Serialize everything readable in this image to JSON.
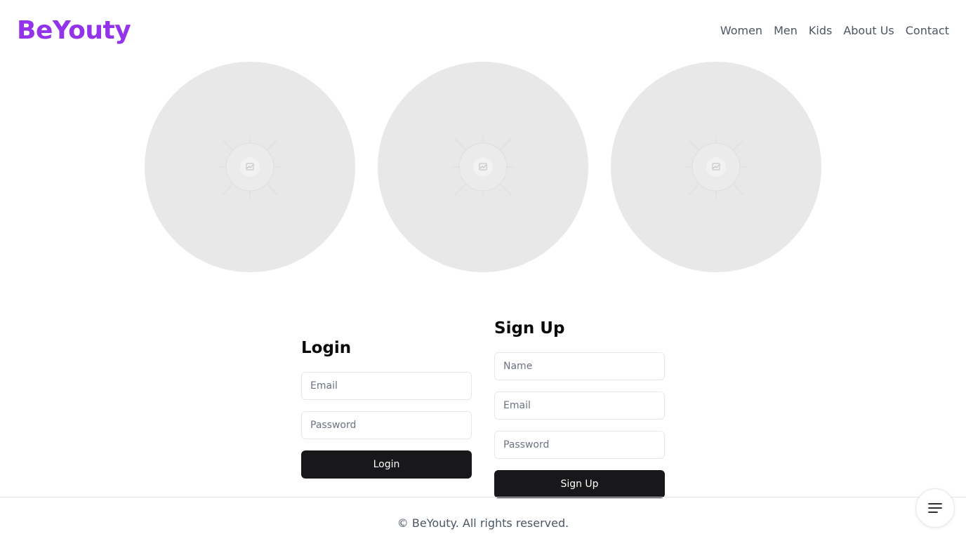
{
  "brand": {
    "name": "BeYouty",
    "color": "#9333ea"
  },
  "nav": {
    "items": [
      {
        "label": "Women"
      },
      {
        "label": "Men"
      },
      {
        "label": "Kids"
      },
      {
        "label": "About Us"
      },
      {
        "label": "Contact"
      }
    ]
  },
  "gallery": {
    "items": [
      {
        "icon": "image-placeholder-icon"
      },
      {
        "icon": "image-placeholder-icon"
      },
      {
        "icon": "image-placeholder-icon"
      }
    ]
  },
  "login": {
    "title": "Login",
    "email_placeholder": "Email",
    "email_value": "",
    "password_placeholder": "Password",
    "password_value": "",
    "button_label": "Login"
  },
  "signup": {
    "title": "Sign Up",
    "name_placeholder": "Name",
    "name_value": "",
    "email_placeholder": "Email",
    "email_value": "",
    "password_placeholder": "Password",
    "password_value": "",
    "button_label": "Sign Up"
  },
  "footer": {
    "copyright": "© BeYouty. All rights reserved."
  },
  "fab": {
    "icon": "menu-icon"
  },
  "colors": {
    "placeholder_bg": "#e8e8e8",
    "button_bg": "#18181b",
    "nav_text": "#4b5563"
  }
}
